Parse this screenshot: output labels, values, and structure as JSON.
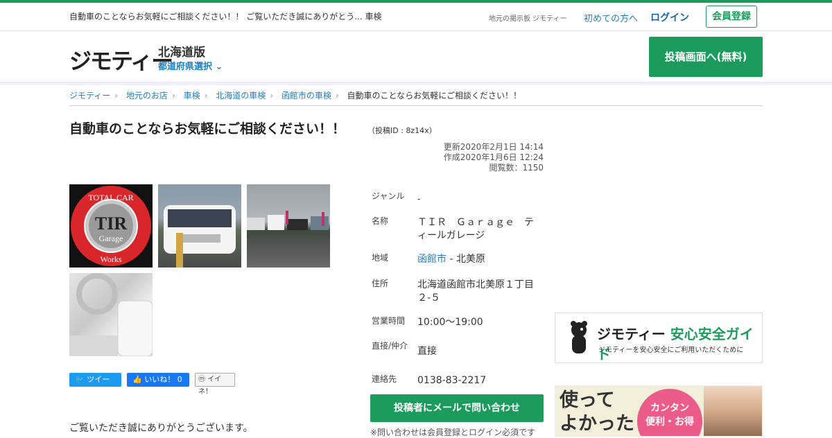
{
  "header": {
    "tagline": "自動車のことならお気軽にご相談ください！！ ご覧いただき誠にありがとう... 車検",
    "local_board": "地元の掲示板 ジモティー",
    "first_time": "初めての方へ",
    "login": "ログイン",
    "register": "会員登録"
  },
  "brand": {
    "logo": "ジモティー",
    "region": "北海道版",
    "pref_select": "都道府県選択 ⌄",
    "post_button": "投稿画面へ(無料)"
  },
  "breadcrumbs": [
    "ジモティー",
    "地元のお店",
    "車検",
    "北海道の車検",
    "函館市の車検"
  ],
  "breadcrumb_current": "自動車のことならお気軽にご相談ください！！",
  "post": {
    "title": "自動車のことならお気軽にご相談ください！！",
    "id": "（投稿ID : 8z14x）",
    "updated": "更新2020年2月1日 14:14",
    "created": "作成2020年1月6日 12:24",
    "views": "閲覧数：1150"
  },
  "logo_image": {
    "top": "TOTAL CAR",
    "middle": "TIR",
    "sub": "Garage",
    "bottom": "Works"
  },
  "share": {
    "tweet": "ツイート",
    "like": "いいね！ 0",
    "iine": "イイネ！"
  },
  "body_text": "ご覧いただき誠にありがとうございます。",
  "details": {
    "genre_label": "ジャンル",
    "genre": "-",
    "name_label": "名称",
    "name": "ＴＩＲ　Ｇａｒａｇｅ　ティールガレージ",
    "area_label": "地域",
    "area_city": "函館市",
    "area_rest": " - 北美原",
    "address_label": "住所",
    "address": "北海道函館市北美原１丁目２-５",
    "hours_label": "営業時間",
    "hours": "10:00〜19:00",
    "direct_label": "直接/仲介",
    "direct": "直接",
    "contact_label": "連絡先",
    "contact": "0138-83-2217"
  },
  "contact_button": "投稿者にメールで問い合わせ",
  "contact_note": "※問い合わせは会員登録とログイン必須です",
  "guide": {
    "title_logo": "ジモティー",
    "title_rest": " 安心安全ガイド",
    "subtitle": "ジモティーを安心安全にご利用いただくために"
  },
  "ad": {
    "line1": "使って",
    "line2": "よかった",
    "bubble1": "カンタン",
    "bubble2": "便利・お得"
  },
  "colors": {
    "brand_green": "#1c9c5c",
    "link_blue": "#1c7fc4"
  }
}
